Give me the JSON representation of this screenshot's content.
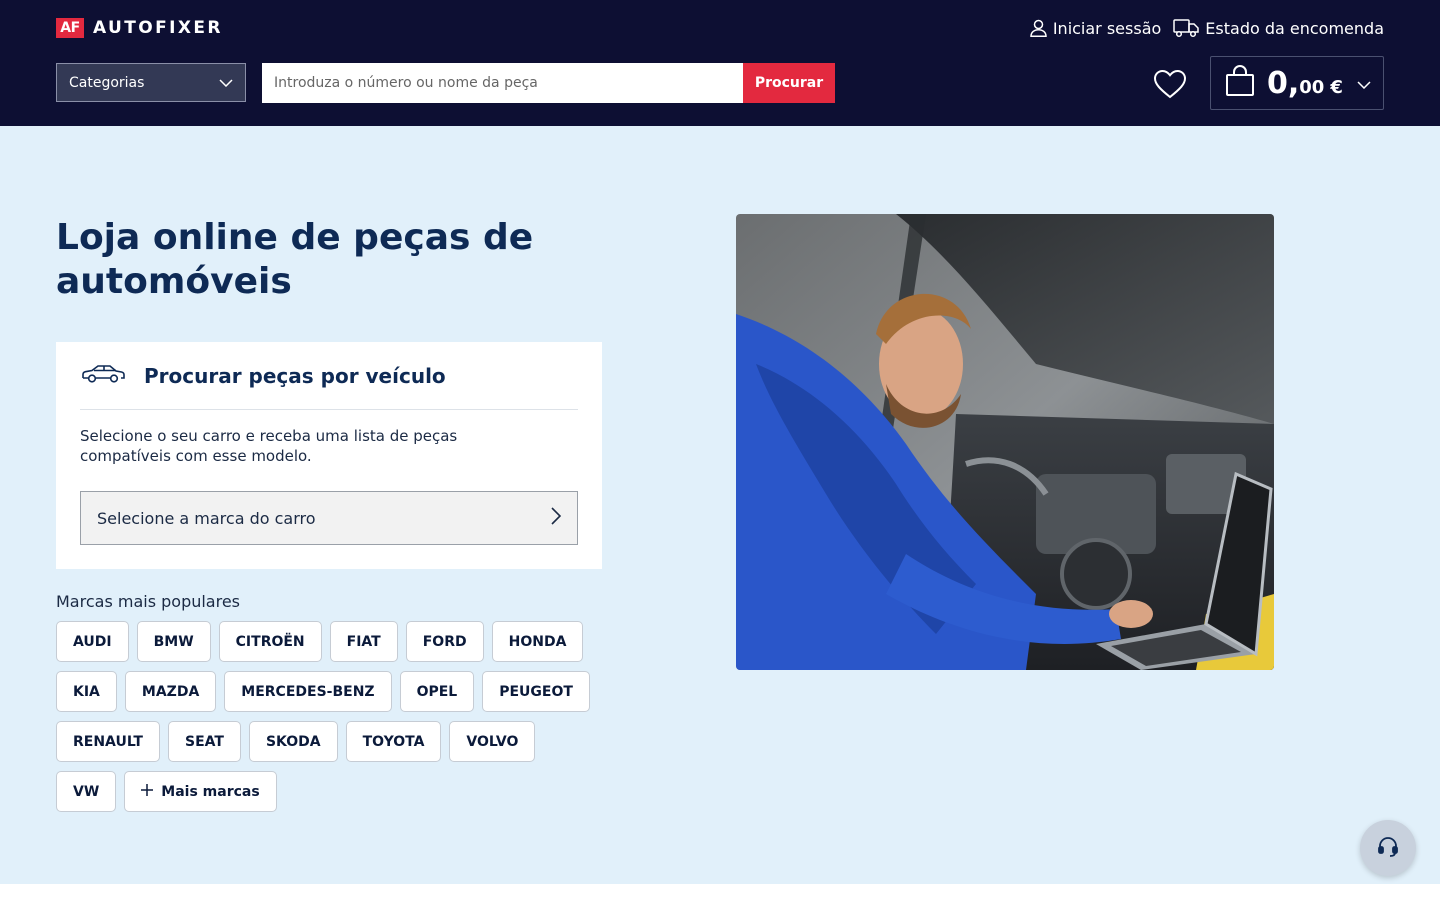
{
  "header": {
    "logo_badge": "AF",
    "logo_text": "AUTOFIXER",
    "login_label": "Iniciar sessão",
    "order_status_label": "Estado da encomenda",
    "categories_label": "Categorias",
    "search_placeholder": "Introduza o número ou nome da peça",
    "search_button": "Procurar",
    "cart": {
      "integer": "0,",
      "decimal": "00",
      "currency": "€"
    }
  },
  "hero": {
    "title": "Loja online de peças de automóveis",
    "vehicle_search": {
      "title": "Procurar peças por veículo",
      "description": "Selecione o seu carro e receba uma lista de peças compatíveis com esse modelo.",
      "select_label": "Selecione a marca do carro"
    },
    "popular_label": "Marcas mais populares",
    "brand_rows": [
      [
        "AUDI",
        "BMW",
        "CITROËN",
        "FIAT",
        "FORD",
        "HONDA"
      ],
      [
        "KIA",
        "MAZDA",
        "MERCEDES-BENZ",
        "OPEL",
        "PEUGEOT"
      ],
      [
        "RENAULT",
        "SEAT",
        "SKODA",
        "TOYOTA",
        "VOLVO"
      ],
      [
        "VW"
      ]
    ],
    "more_brands": "Mais marcas"
  },
  "colors": {
    "header_bg": "#0d0f33",
    "accent_red": "#e3293f",
    "hero_bg": "#e1f0fa",
    "title_navy": "#0e2a55"
  },
  "icons": [
    "user-icon",
    "truck-icon",
    "chevron-down-icon",
    "heart-icon",
    "shopping-bag-icon",
    "car-icon",
    "chevron-right-icon",
    "plus-icon",
    "headset-icon"
  ]
}
